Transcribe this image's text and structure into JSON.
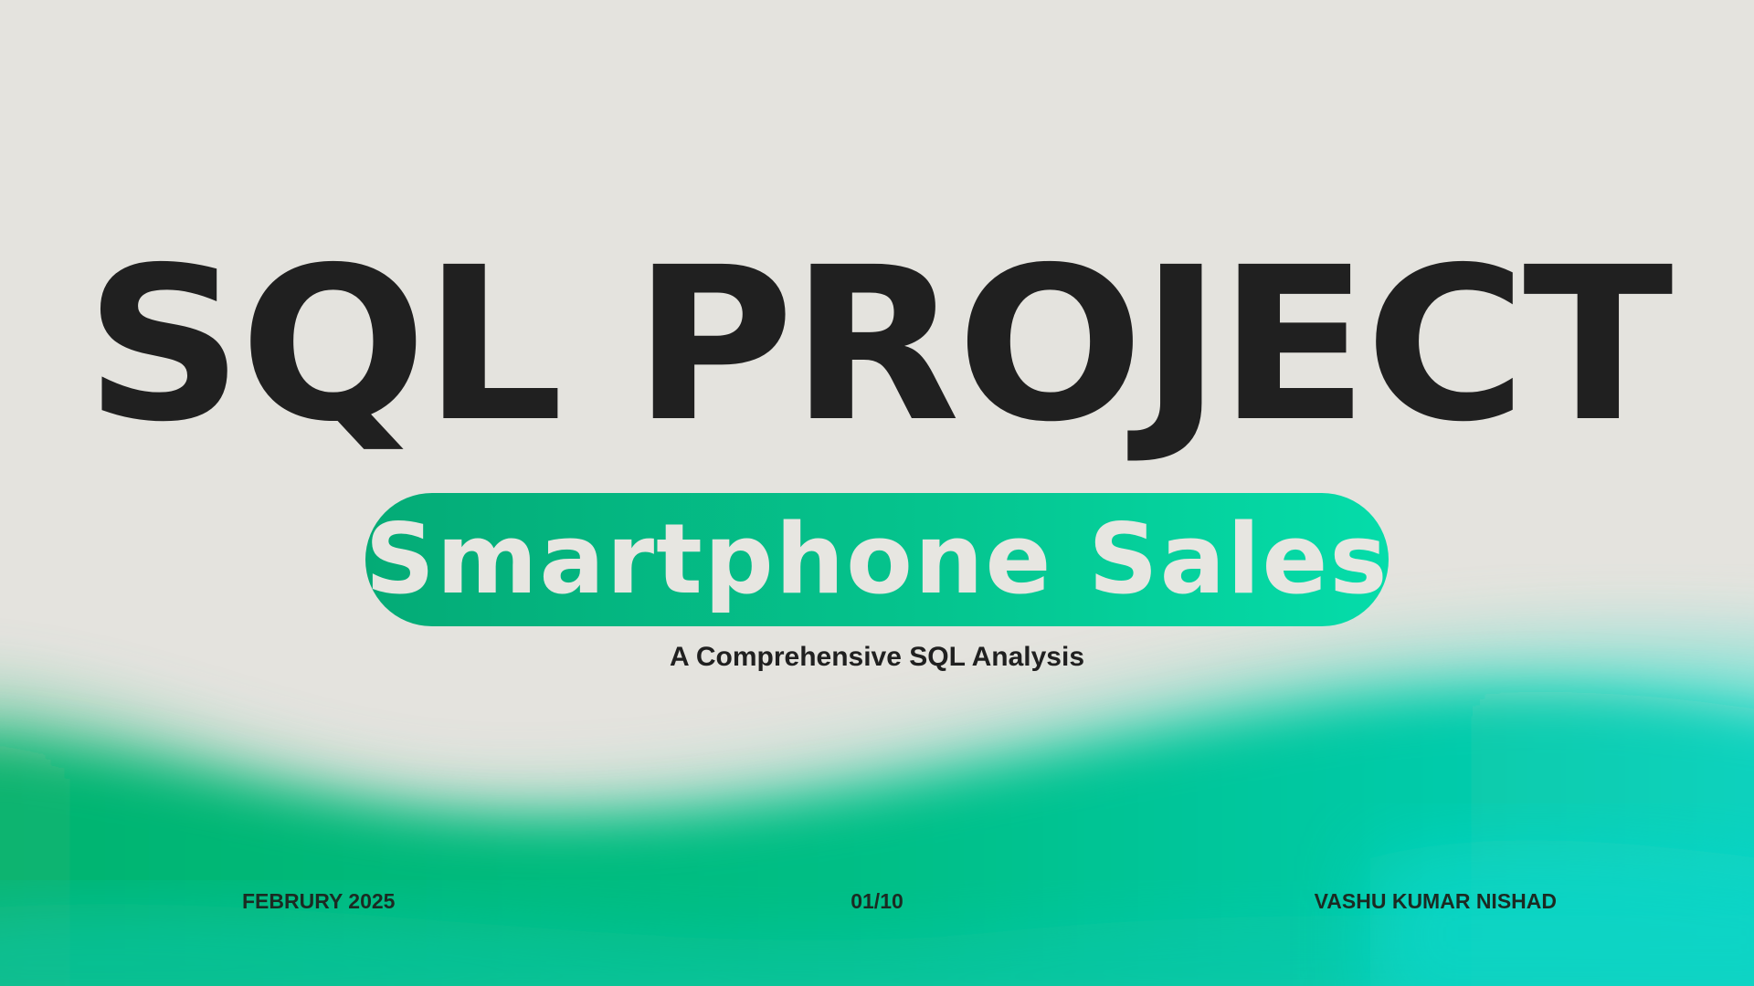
{
  "slide": {
    "title": "SQL PROJECT",
    "subtitle_pill": "Smartphone Sales",
    "tagline": "A Comprehensive SQL Analysis"
  },
  "footer": {
    "date": "FEBRURY 2025",
    "page": "01/10",
    "author": "VASHU KUMAR NISHAD"
  },
  "colors": {
    "background": "#e4e3de",
    "text_dark": "#202020",
    "accent_green": "#05c48e",
    "accent_teal": "#05dcc4",
    "pill_text": "#e7e6e1"
  }
}
